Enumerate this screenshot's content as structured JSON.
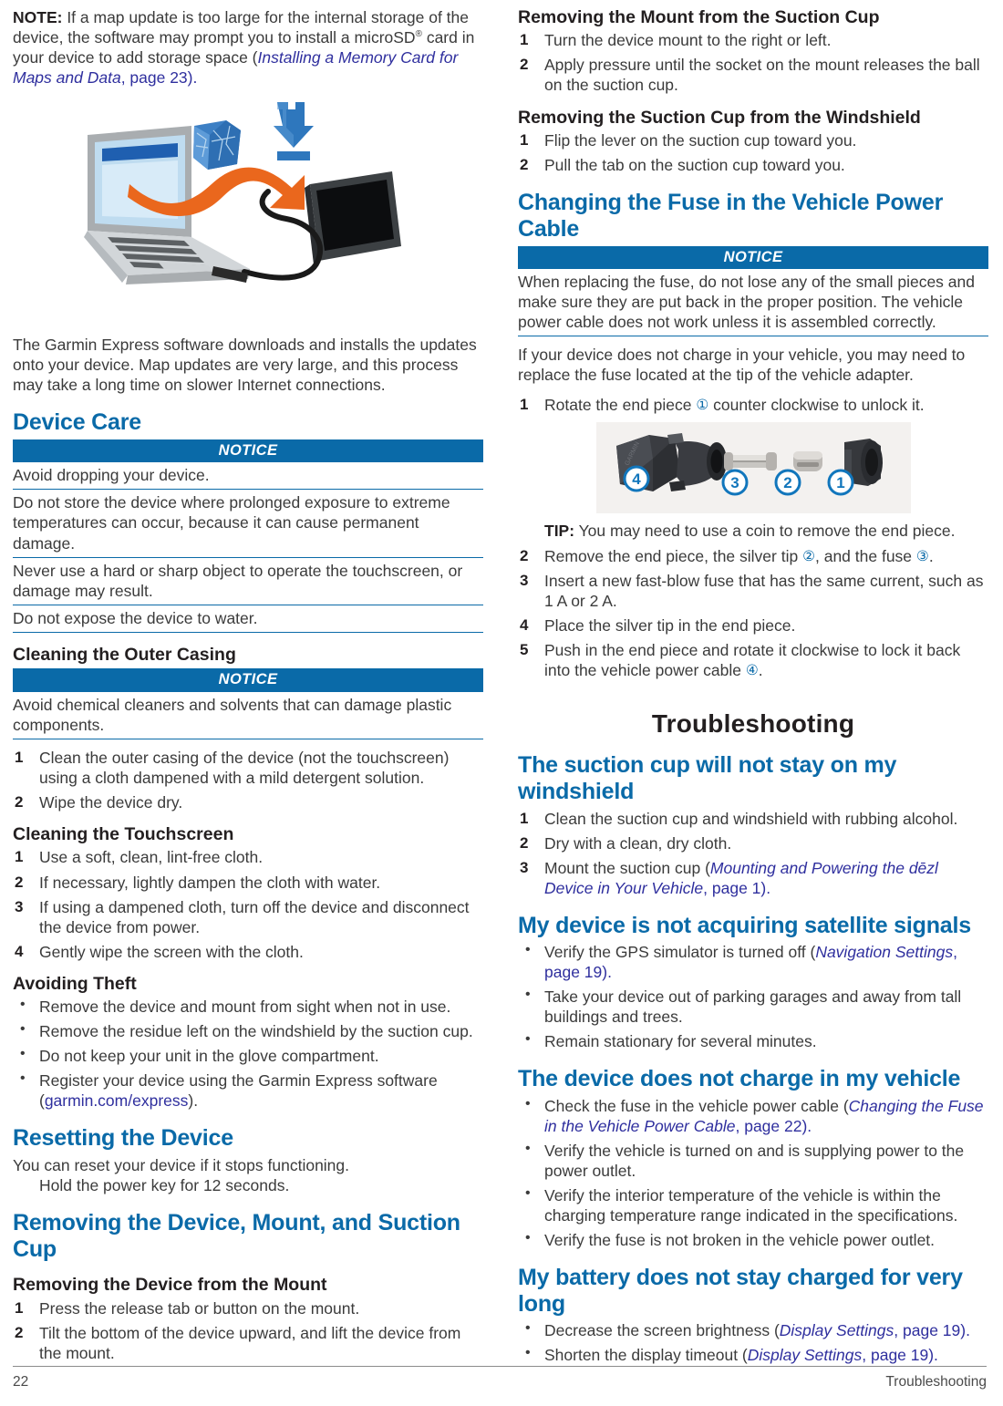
{
  "left_column": {
    "note": {
      "label": "NOTE:",
      "text_a": " If a map update is too large for the internal storage of the device, the software may prompt you to install a microSD",
      "sup": "®",
      "text_b": " card in your device to add storage space (",
      "xref": "Installing a Memory Card for Maps and Data",
      "text_c": ", page 23).",
      "page": "page 23"
    },
    "figure_map_update": "map-update-laptop-to-device-illustration",
    "paragraph_express": "The Garmin Express software downloads and installs the updates onto your device. Map updates are very large, and this process may take a long time on slower Internet connections.",
    "device_care": {
      "heading": "Device Care",
      "notice_label": "NOTICE",
      "notices": [
        "Avoid dropping your device.",
        "Do not store the device where prolonged exposure to extreme temperatures can occur, because it can cause permanent damage.",
        "Never use a hard or sharp object to operate the touchscreen, or damage may result.",
        "Do not expose the device to water."
      ]
    },
    "cleaning_outer_casing": {
      "heading": "Cleaning the Outer Casing",
      "notice_label": "NOTICE",
      "notice": "Avoid chemical cleaners and solvents that can damage plastic components.",
      "steps": [
        "Clean the outer casing of the device (not the touchscreen) using a cloth dampened with a mild detergent solution.",
        "Wipe the device dry."
      ]
    },
    "cleaning_touchscreen": {
      "heading": "Cleaning the Touchscreen",
      "steps": [
        "Use a soft, clean, lint-free cloth.",
        "If necessary, lightly dampen the cloth with water.",
        "If using a dampened cloth, turn off the device and disconnect the device from power.",
        "Gently wipe the screen with the cloth."
      ]
    },
    "avoiding_theft": {
      "heading": "Avoiding Theft",
      "bullets": [
        "Remove the device and mount from sight when not in use.",
        "Remove the residue left on the windshield by the suction cup.",
        "Do not keep your unit in the glove compartment."
      ],
      "bullet_register_pre": "Register your device using the Garmin Express software (",
      "bullet_register_link": "garmin.com/express",
      "bullet_register_post": ")."
    },
    "resetting_device": {
      "heading": "Resetting the Device",
      "intro": "You can reset your device if it stops functioning.",
      "action": "Hold the power key for 12 seconds."
    },
    "removing_group": {
      "heading": "Removing the Device, Mount, and Suction Cup",
      "sub_heading": "Removing the Device from the Mount",
      "steps": [
        "Press the release tab or button on the mount.",
        "Tilt the bottom of the device upward, and lift the device from the mount."
      ]
    }
  },
  "right_column": {
    "removing_mount_from_cup": {
      "heading": "Removing the Mount from the Suction Cup",
      "steps": [
        "Turn the device mount to the right or left.",
        "Apply pressure until the socket on the mount releases the ball on the suction cup."
      ]
    },
    "removing_cup_from_windshield": {
      "heading": "Removing the Suction Cup from the Windshield",
      "steps": [
        "Flip the lever on the suction cup toward you.",
        "Pull the tab on the suction cup toward you."
      ]
    },
    "changing_fuse": {
      "heading": "Changing the Fuse in the Vehicle Power Cable",
      "notice_label": "NOTICE",
      "notice": "When replacing the fuse, do not lose any of the small pieces and make sure they are put back in the proper position. The vehicle power cable does not work unless it is assembled correctly.",
      "intro": "If your device does not charge in your vehicle, you may need to replace the fuse located at the tip of the vehicle adapter.",
      "step1_pre": "Rotate the end piece ",
      "step1_circ": "①",
      "step1_post": " counter clockwise to unlock it.",
      "figure": "vehicle-power-cable-exploded-parts-illustration",
      "figure_callouts": [
        "4",
        "3",
        "2",
        "1"
      ],
      "tip_label": "TIP:",
      "tip_text": " You may need to use a coin to remove the end piece.",
      "step2_pre": "Remove the end piece, the silver tip ",
      "step2_circ_a": "②",
      "step2_mid": ", and the fuse ",
      "step2_circ_b": "③",
      "step2_post": ".",
      "step3": "Insert a new fast-blow fuse that has the same current, such as 1 A or 2 A.",
      "step4": "Place the silver tip in the end piece.",
      "step5_pre": "Push in the end piece and rotate it clockwise to lock it back into the vehicle power cable ",
      "step5_circ": "④",
      "step5_post": "."
    },
    "troubleshooting_title": "Troubleshooting",
    "suction_cup_issue": {
      "heading": "The suction cup will not stay on my windshield",
      "step1": "Clean the suction cup and windshield with rubbing alcohol.",
      "step2": "Dry with a clean, dry cloth.",
      "step3_pre": "Mount the suction cup (",
      "step3_xref": "Mounting and Powering the dēzl Device in Your Vehicle",
      "step3_post": ", page 1)."
    },
    "satellite_issue": {
      "heading": "My device is not acquiring satellite signals",
      "bullet1_pre": "Verify the GPS simulator is turned off (",
      "bullet1_xref": "Navigation Settings",
      "bullet1_post": ", page 19).",
      "bullet2": "Take your device out of parking garages and away from tall buildings and trees.",
      "bullet3": "Remain stationary for several minutes."
    },
    "charge_issue": {
      "heading": "The device does not charge in my vehicle",
      "bullet1_pre": "Check the fuse in the vehicle power cable (",
      "bullet1_xref": "Changing the Fuse in the Vehicle Power Cable",
      "bullet1_post": ", page 22).",
      "bullet2": "Verify the vehicle is turned on and is supplying power to the power outlet.",
      "bullet3": "Verify the interior temperature of the vehicle is within the charging temperature range indicated in the specifications.",
      "bullet4": "Verify the fuse is not broken in the vehicle power outlet."
    },
    "battery_issue": {
      "heading": "My battery does not stay charged for very long",
      "bullet1_pre": "Decrease the screen brightness (",
      "bullet1_xref": "Display Settings",
      "bullet1_post": ", page 19).",
      "bullet2_pre": "Shorten the display timeout (",
      "bullet2_xref": "Display Settings",
      "bullet2_post": ", page 19)."
    }
  },
  "footer": {
    "page_number": "22",
    "section": "Troubleshooting"
  },
  "colors": {
    "heading_blue": "#0a6aa8",
    "notice_bar": "#0a6aa8",
    "xref_blue": "#2f2f9e",
    "body_text": "#3b3b3b",
    "black_heading": "#231f20"
  }
}
